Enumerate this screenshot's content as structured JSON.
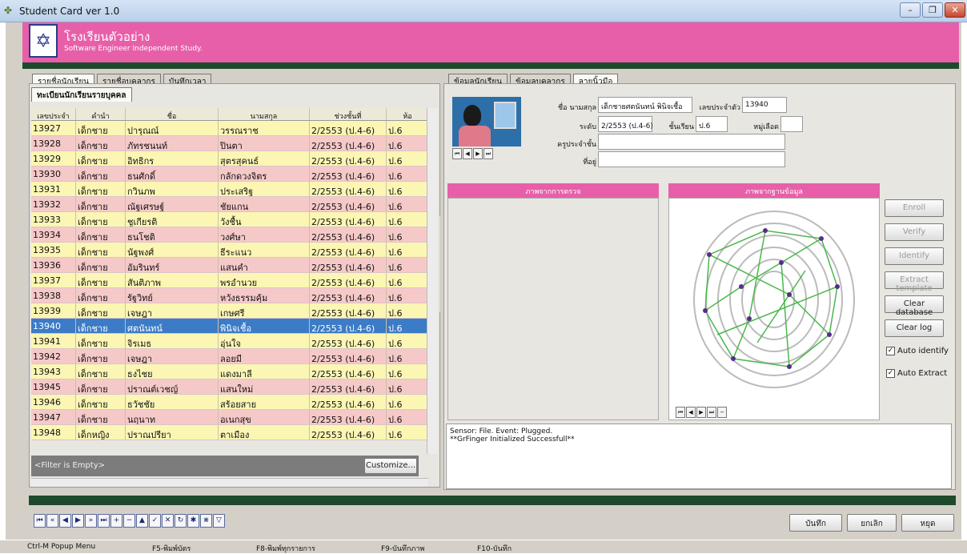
{
  "window": {
    "title": "Student Card ver 1.0",
    "icon": "app-icon",
    "controls": [
      "minimize-icon",
      "maximize-icon",
      "close-icon"
    ]
  },
  "header": {
    "school_name": "โรงเรียนตัวอย่าง",
    "subtitle": "Software Engineer Independent Study."
  },
  "left_tabs": [
    "รายชื่อนักเรียน",
    "รายชื่อบุคลากร",
    "บันทึกเวลา"
  ],
  "left_subtab": "ทะเบียนนักเรียนรายบุคคล",
  "grid": {
    "headers": [
      "เลขประจำตัว",
      "คำนำ",
      "ชื่อ",
      "นามสกุล",
      "ช่วงชั้นที่",
      "ห้อ"
    ],
    "rows": [
      [
        "13927",
        "เด็กชาย",
        "ปารุณณ์",
        "วรรณราช",
        "2/2553 (ป.4-6)",
        "ป.6"
      ],
      [
        "13928",
        "เด็กชาย",
        "ภัทรชนนท์",
        "ปินตา",
        "2/2553 (ป.4-6)",
        "ป.6"
      ],
      [
        "13929",
        "เด็กชาย",
        "อิทธิกร",
        "สุตรสุคนธ์",
        "2/2553 (ป.4-6)",
        "ป.6"
      ],
      [
        "13930",
        "เด็กชาย",
        "ธนศักดิ์",
        "กลักดวงจิตร",
        "2/2553 (ป.4-6)",
        "ป.6"
      ],
      [
        "13931",
        "เด็กชาย",
        "กวินภพ",
        "ประเสริฐ",
        "2/2553 (ป.4-6)",
        "ป.6"
      ],
      [
        "13932",
        "เด็กชาย",
        "ณัฐเศรษฐ์",
        "ชัยแกน",
        "2/2553 (ป.4-6)",
        "ป.6"
      ],
      [
        "13933",
        "เด็กชาย",
        "ชูเกียรติ",
        "วังชื้น",
        "2/2553 (ป.4-6)",
        "ป.6"
      ],
      [
        "13934",
        "เด็กชาย",
        "ธนโชติ",
        "วงศ์ษา",
        "2/2553 (ป.4-6)",
        "ป.6"
      ],
      [
        "13935",
        "เด็กชาย",
        "นัฐพงศ์",
        "ธีระแนว",
        "2/2553 (ป.4-6)",
        "ป.6"
      ],
      [
        "13936",
        "เด็กชาย",
        "อัมรินทร์",
        "แสนคำ",
        "2/2553 (ป.4-6)",
        "ป.6"
      ],
      [
        "13937",
        "เด็กชาย",
        "สันติภาพ",
        "พรอำนวย",
        "2/2553 (ป.4-6)",
        "ป.6"
      ],
      [
        "13938",
        "เด็กชาย",
        "รัฐวิทย์",
        "หวังธรรมคุ้ม",
        "2/2553 (ป.4-6)",
        "ป.6"
      ],
      [
        "13939",
        "เด็กชาย",
        "เจษฎา",
        "เกษศรี",
        "2/2553 (ป.4-6)",
        "ป.6"
      ],
      [
        "13940",
        "เด็กชาย",
        "ศตนันทน์",
        "พินิจเชื้อ",
        "2/2553 (ป.4-6)",
        "ป.6"
      ],
      [
        "13941",
        "เด็กชาย",
        "จิรเมธ",
        "อุ่นใจ",
        "2/2553 (ป.4-6)",
        "ป.6"
      ],
      [
        "13942",
        "เด็กชาย",
        "เจษฎา",
        "ลอยมี",
        "2/2553 (ป.4-6)",
        "ป.6"
      ],
      [
        "13943",
        "เด็กชาย",
        "ธงไชย",
        "แดงมาลี",
        "2/2553 (ป.4-6)",
        "ป.6"
      ],
      [
        "13945",
        "เด็กชาย",
        "ปราณต์เวชญ์",
        "แสนใหม่",
        "2/2553 (ป.4-6)",
        "ป.6"
      ],
      [
        "13946",
        "เด็กชาย",
        "ธวัชชัย",
        "สร้อยสาย",
        "2/2553 (ป.4-6)",
        "ป.6"
      ],
      [
        "13947",
        "เด็กชาย",
        "นฤนาท",
        "อเนกสุข",
        "2/2553 (ป.4-6)",
        "ป.6"
      ],
      [
        "13948",
        "เด็กหญิง",
        "ปราณปรียา",
        "ตาเมือง",
        "2/2553 (ป.4-6)",
        "ป.6"
      ]
    ],
    "filter_text": "<Filter is Empty>",
    "customize_label": "Customize..."
  },
  "right_tabs": [
    "ข้อมูลนักเรียน",
    "ข้อมูลบุคลากร",
    "ลายนิ้วมือ"
  ],
  "student": {
    "name_label": "ชื่อ นามสกุล",
    "name_value": "เด็กชายศตนันทน์ พินิจเชื้อ",
    "id_label": "เลขประจำตัว",
    "id_value": "13940",
    "level_label": "ระดับ",
    "level_value": "2/2553 (ป.4-6)",
    "class_label": "ชั้นเรียน",
    "class_value": "ป.6",
    "blood_label": "หมู่เลือด",
    "blood_value": "",
    "teacher_label": "ครูประจำชั้น",
    "teacher_value": "",
    "address_label": "ที่อยู่",
    "address_value": ""
  },
  "fingerprint": {
    "scan_title": "ภาพจากการตรวจ",
    "db_title": "ภาพจากฐานข้อมูล",
    "buttons": {
      "enroll": "Enroll",
      "verify": "Verify",
      "identify": "Identify",
      "extract": "Extract template",
      "clear_db": "Clear database",
      "clear_log": "Clear log"
    },
    "auto_identify": "Auto identify",
    "auto_extract": "Auto Extract",
    "log_line1": "Sensor: File. Event: Plugged.",
    "log_line2": "**GrFinger Initialized Successfull**"
  },
  "actions": {
    "save": "บันทึก",
    "cancel": "ยกเลิก",
    "stop": "หยุด"
  },
  "status": {
    "s1": "Ctrl-M  Popup Menu",
    "s2": "F5-พิมพ์บัตร",
    "s3": "F8-พิมพ์ทุกรายการ",
    "s4": "F9-บันทึกภาพ",
    "s5": "F10-บันทึก"
  }
}
